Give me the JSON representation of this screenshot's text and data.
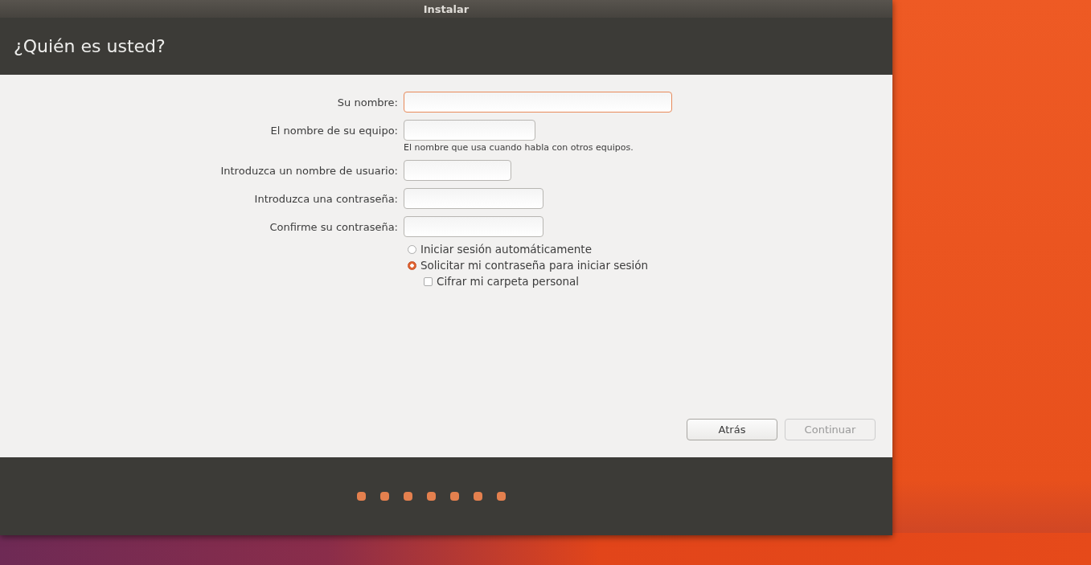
{
  "window": {
    "title": "Instalar"
  },
  "header": {
    "title": "¿Quién es usted?"
  },
  "fields": [
    {
      "label": "Su nombre:",
      "focused": true
    },
    {
      "label": "El nombre de su equipo:",
      "focused": false,
      "hint": "El nombre que usa cuando habla con otros equipos."
    },
    {
      "label": "Introduzca un nombre de usuario:",
      "focused": false
    },
    {
      "label": "Introduzca una contraseña:",
      "focused": false
    },
    {
      "label": "Confirme su contraseña:",
      "focused": false
    }
  ],
  "login_options": [
    {
      "label": "Iniciar sesión automáticamente",
      "selected": false
    },
    {
      "label": "Solicitar mi contraseña para iniciar sesión",
      "selected": true
    }
  ],
  "encrypt": {
    "label": "Cifrar mi carpeta personal",
    "checked": false
  },
  "buttons": [
    {
      "label": "Atrás",
      "disabled": false
    },
    {
      "label": "Continuar",
      "disabled": true
    }
  ]
}
